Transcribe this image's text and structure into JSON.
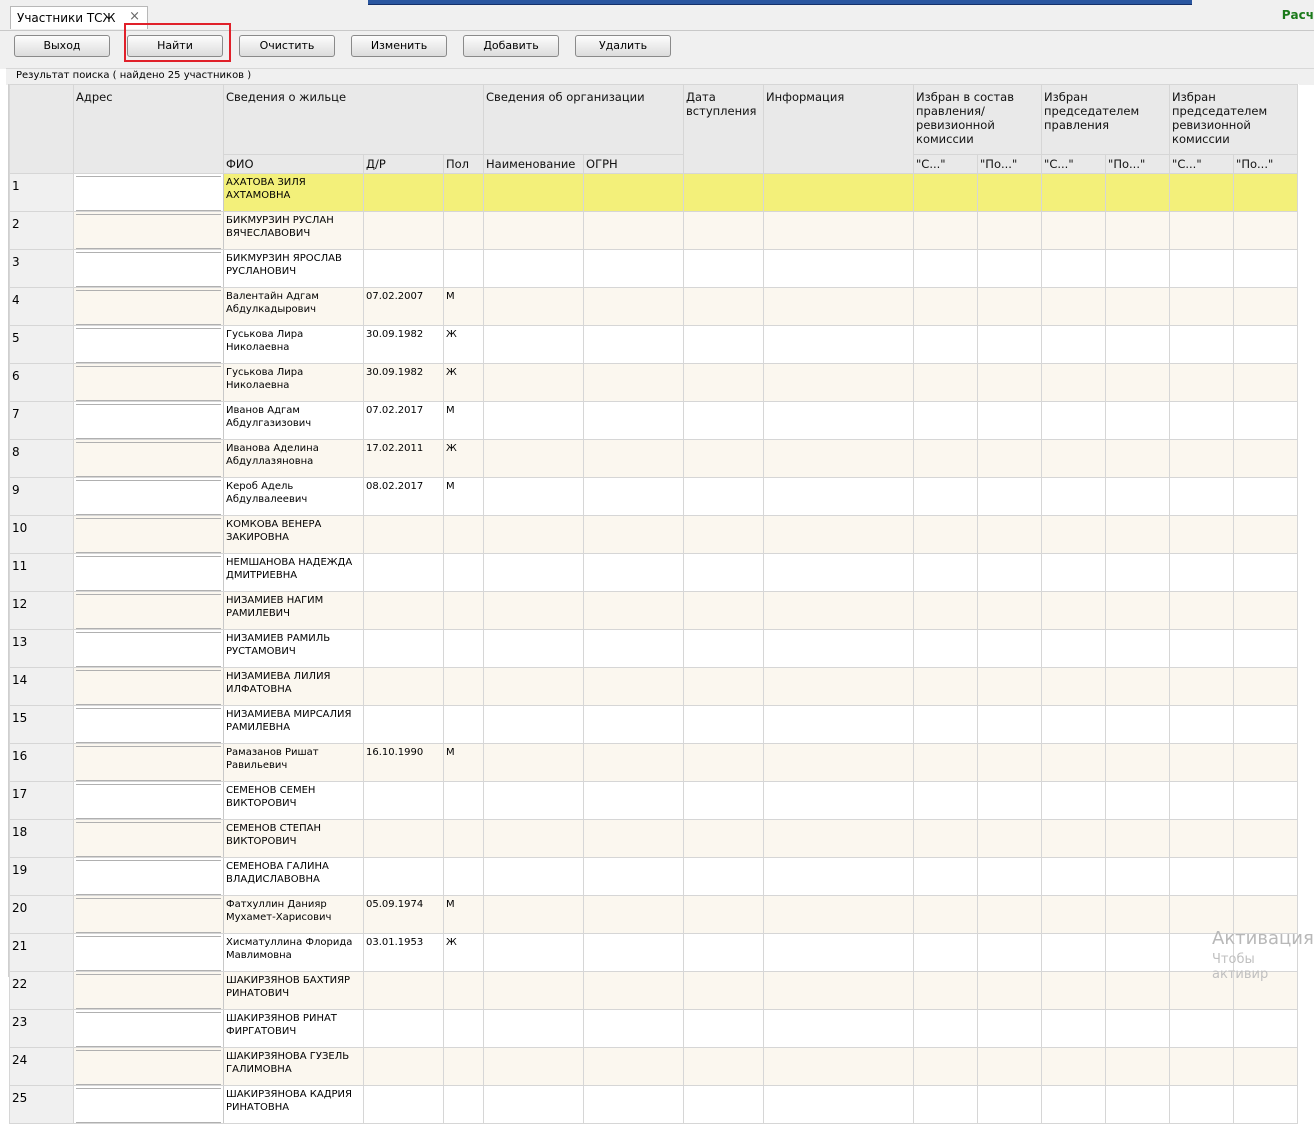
{
  "tab": {
    "title": "Участники ТСЖ",
    "close": "×"
  },
  "top_right": "Расч",
  "toolbar": {
    "exit": "Выход",
    "find": "Найти",
    "clear": "Очистить",
    "edit": "Изменить",
    "add": "Добавить",
    "delete": "Удалить"
  },
  "result_label": "Результат поиска  ( найдено 25 участников )",
  "headers": {
    "address": "Адрес",
    "resident": "Сведения о жильце",
    "organization": "Сведения об организации",
    "join_date": "Дата вступления",
    "info": "Информация",
    "elected_board": "Избран в состав правления/ревизионной комиссии",
    "elected_chair": "Избран председателем правления",
    "elected_audit": "Избран председателем ревизионной комиссии",
    "fio": "ФИО",
    "dob": "Д/Р",
    "sex": "Пол",
    "org_name": "Наименование",
    "ogrn": "ОГРН",
    "from1": "\"С...\"",
    "to1": "\"По...\"",
    "from2": "\"С...\"",
    "to2": "\"По...\"",
    "from3": "\"С...\"",
    "to3": "\"По...\""
  },
  "rows": [
    {
      "n": "1",
      "fio": "АХАТОВА ЗИЛЯ АХТАМОВНА",
      "dob": "",
      "sex": ""
    },
    {
      "n": "2",
      "fio": "БИКМУРЗИН РУСЛАН ВЯЧЕСЛАВОВИЧ",
      "dob": "",
      "sex": ""
    },
    {
      "n": "3",
      "fio": "БИКМУРЗИН ЯРОСЛАВ РУСЛАНОВИЧ",
      "dob": "",
      "sex": ""
    },
    {
      "n": "4",
      "fio": "Валентайн Адгам Абдулкадырович",
      "dob": "07.02.2007",
      "sex": "М"
    },
    {
      "n": "5",
      "fio": "Гуськова Лира Николаевна",
      "dob": "30.09.1982",
      "sex": "Ж"
    },
    {
      "n": "6",
      "fio": "Гуськова Лира Николаевна",
      "dob": "30.09.1982",
      "sex": "Ж"
    },
    {
      "n": "7",
      "fio": "Иванов Адгам Абдулгазизович",
      "dob": "07.02.2017",
      "sex": "М"
    },
    {
      "n": "8",
      "fio": "Иванова Аделина Абдуллазяновна",
      "dob": "17.02.2011",
      "sex": "Ж"
    },
    {
      "n": "9",
      "fio": "Кероб Адель Абдулвалеевич",
      "dob": "08.02.2017",
      "sex": "М"
    },
    {
      "n": "10",
      "fio": "КОМКОВА ВЕНЕРА ЗАКИРОВНА",
      "dob": "",
      "sex": ""
    },
    {
      "n": "11",
      "fio": "НЕМШАНОВА НАДЕЖДА ДМИТРИЕВНА",
      "dob": "",
      "sex": ""
    },
    {
      "n": "12",
      "fio": "НИЗАМИЕВ НАГИМ РАМИЛЕВИЧ",
      "dob": "",
      "sex": ""
    },
    {
      "n": "13",
      "fio": "НИЗАМИЕВ РАМИЛЬ РУСТАМОВИЧ",
      "dob": "",
      "sex": ""
    },
    {
      "n": "14",
      "fio": "НИЗАМИЕВА ЛИЛИЯ ИЛФАТОВНА",
      "dob": "",
      "sex": ""
    },
    {
      "n": "15",
      "fio": "НИЗАМИЕВА МИРСАЛИЯ РАМИЛЕВНА",
      "dob": "",
      "sex": ""
    },
    {
      "n": "16",
      "fio": "Рамазанов Ришат Равильевич",
      "dob": "16.10.1990",
      "sex": "М"
    },
    {
      "n": "17",
      "fio": "СЕМЕНОВ СЕМЕН ВИКТОРОВИЧ",
      "dob": "",
      "sex": ""
    },
    {
      "n": "18",
      "fio": "СЕМЕНОВ СТЕПАН ВИКТОРОВИЧ",
      "dob": "",
      "sex": ""
    },
    {
      "n": "19",
      "fio": "СЕМЕНОВА ГАЛИНА ВЛАДИСЛАВОВНА",
      "dob": "",
      "sex": ""
    },
    {
      "n": "20",
      "fio": "Фатхуллин Данияр Мухамет-Харисович",
      "dob": "05.09.1974",
      "sex": "М"
    },
    {
      "n": "21",
      "fio": "Хисматуллина Флорида Мавлимовна",
      "dob": "03.01.1953",
      "sex": "Ж"
    },
    {
      "n": "22",
      "fio": "ШАКИРЗЯНОВ БАХТИЯР РИНАТОВИЧ",
      "dob": "",
      "sex": ""
    },
    {
      "n": "23",
      "fio": "ШАКИРЗЯНОВ РИНАТ ФИРГАТОВИЧ",
      "dob": "",
      "sex": ""
    },
    {
      "n": "24",
      "fio": "ШАКИРЗЯНОВА ГУЗЕЛЬ ГАЛИМОВНА",
      "dob": "",
      "sex": ""
    },
    {
      "n": "25",
      "fio": "ШАКИРЗЯНОВА КАДРИЯ РИНАТОВНА",
      "dob": "",
      "sex": ""
    }
  ],
  "watermark": {
    "line1": "Активация",
    "line2": "Чтобы активир"
  },
  "colors": {
    "selected_row": "#f3f07a",
    "alt_row": "#fbf7ef",
    "highlight_box": "#e0202a"
  }
}
